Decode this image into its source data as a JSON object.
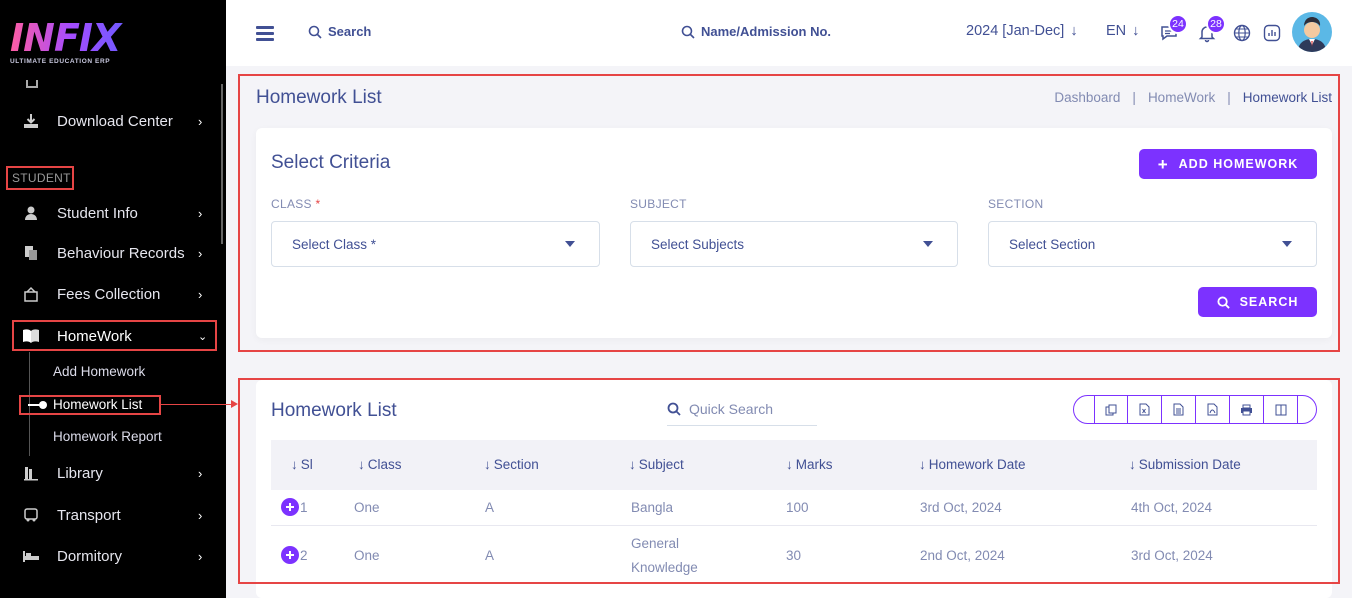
{
  "app": {
    "logo_text": "INFIX",
    "logo_sub": "ULTIMATE EDUCATION ERP"
  },
  "sidebar": {
    "items_top": [
      {
        "label": "Download Center",
        "icon": "download-icon"
      }
    ],
    "section_label": "STUDENT",
    "items": [
      {
        "label": "Student Info",
        "icon": "user-icon"
      },
      {
        "label": "Behaviour Records",
        "icon": "copy-icon"
      },
      {
        "label": "Fees Collection",
        "icon": "fees-icon"
      },
      {
        "label": "HomeWork",
        "icon": "book-icon"
      },
      {
        "label": "Library",
        "icon": "library-icon"
      },
      {
        "label": "Transport",
        "icon": "bus-icon"
      },
      {
        "label": "Dormitory",
        "icon": "bed-icon"
      }
    ],
    "homework_sub": [
      "Add Homework",
      "Homework List",
      "Homework Report"
    ]
  },
  "topbar": {
    "search_label": "Search",
    "search2_label": "Name/Admission No.",
    "session": "2024 [Jan-Dec]",
    "language": "EN",
    "messages_count": "24",
    "notifications_count": "28"
  },
  "page": {
    "title": "Homework List",
    "breadcrumb": [
      "Dashboard",
      "HomeWork",
      "Homework List"
    ]
  },
  "criteria": {
    "title": "Select Criteria",
    "add_button": "ADD HOMEWORK",
    "class_label": "CLASS",
    "class_required": "*",
    "class_placeholder": "Select Class *",
    "subject_label": "SUBJECT",
    "subject_placeholder": "Select Subjects",
    "section_label": "SECTION",
    "section_placeholder": "Select Section",
    "search_button": "SEARCH"
  },
  "list": {
    "title": "Homework List",
    "quick_search_placeholder": "Quick Search",
    "columns": [
      "Sl",
      "Class",
      "Section",
      "Subject",
      "Marks",
      "Homework Date",
      "Submission Date"
    ],
    "rows": [
      {
        "sl": "1",
        "class": "One",
        "section": "A",
        "subject": "Bangla",
        "subject_line2": "",
        "marks": "100",
        "hw_date": "3rd Oct, 2024",
        "sub_date": "4th Oct, 2024"
      },
      {
        "sl": "2",
        "class": "One",
        "section": "A",
        "subject": "General",
        "subject_line2": "Knowledge",
        "marks": "30",
        "hw_date": "2nd Oct, 2024",
        "sub_date": "3rd Oct, 2024"
      }
    ]
  },
  "colors": {
    "accent": "#7c32ff",
    "text": "#415094",
    "muted": "#828bb2",
    "highlight": "#e64545"
  }
}
